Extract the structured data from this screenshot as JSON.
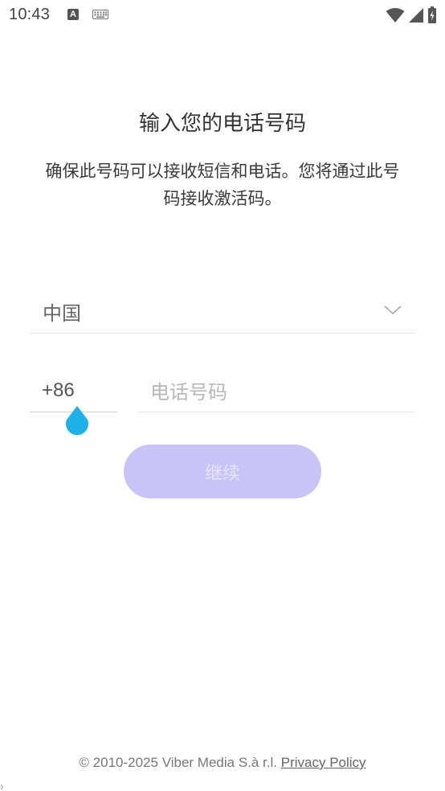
{
  "status_bar": {
    "time": "10:43",
    "notification_letter": "A",
    "icons": [
      "text-notification-icon",
      "keyboard-icon",
      "wifi-icon",
      "cellular-signal-icon",
      "battery-icon"
    ]
  },
  "header": {
    "title": "输入您的电话号码",
    "subtitle": "确保此号码可以接收短信和电话。您将通过此号码接收激活码。"
  },
  "form": {
    "country": "中国",
    "country_code": "+86",
    "phone_placeholder": "电话号码",
    "phone_value": "",
    "continue_label": "继续"
  },
  "footer": {
    "copyright": "© 2010-2025 Viber Media S.à r.l.",
    "privacy_link": "Privacy Policy"
  },
  "colors": {
    "button_disabled_bg": "#c9c3f7",
    "button_disabled_text": "#e6e3fb",
    "cursor_handle": "#1eb0e8"
  }
}
